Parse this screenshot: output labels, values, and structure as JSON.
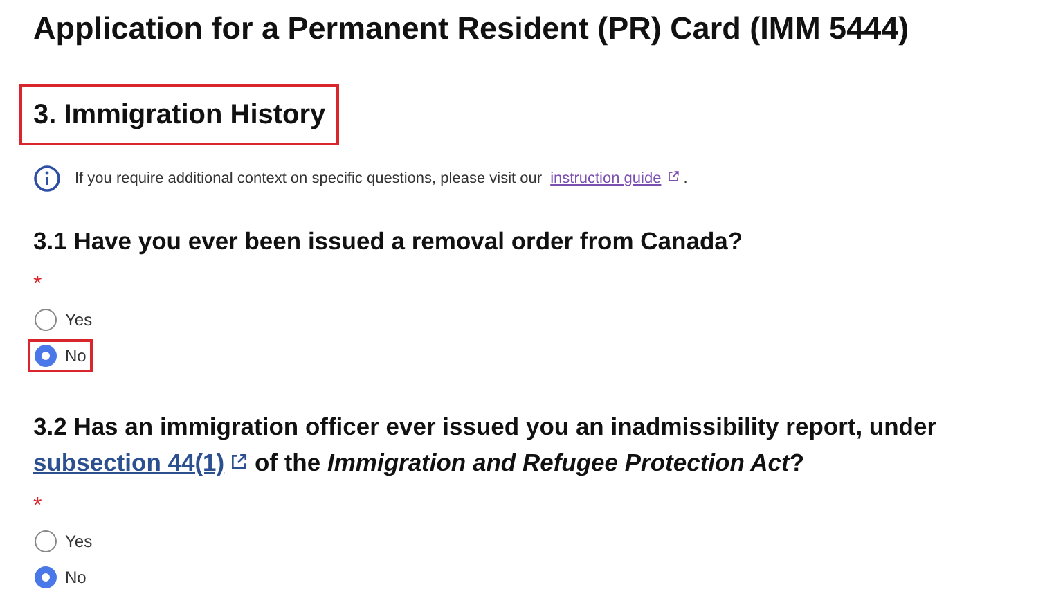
{
  "page_title": "Application for a Permanent Resident (PR) Card (IMM 5444)",
  "section": {
    "title": "3. Immigration History",
    "highlighted": true
  },
  "info": {
    "text": "If you require additional context on specific questions, please visit our",
    "link": "instruction guide",
    "after": "."
  },
  "questions": [
    {
      "parts": [
        {
          "kind": "text",
          "text": "3.1 Have you ever been issued a removal order from Canada?"
        }
      ],
      "required_mark": "*",
      "options": [
        {
          "label": "Yes",
          "selected": false,
          "highlighted": false
        },
        {
          "label": "No",
          "selected": true,
          "highlighted": true
        }
      ]
    },
    {
      "parts": [
        {
          "kind": "text",
          "text": "3.2 Has an immigration officer ever issued you an inadmissibility report, under "
        },
        {
          "kind": "link",
          "text": "subsection 44(1)"
        },
        {
          "kind": "text",
          "text": " of the *Immigration and Refugee Protection Act*?"
        }
      ],
      "required_mark": "*",
      "options": [
        {
          "label": "Yes",
          "selected": false,
          "highlighted": false
        },
        {
          "label": "No",
          "selected": true,
          "highlighted": false
        }
      ]
    }
  ]
}
